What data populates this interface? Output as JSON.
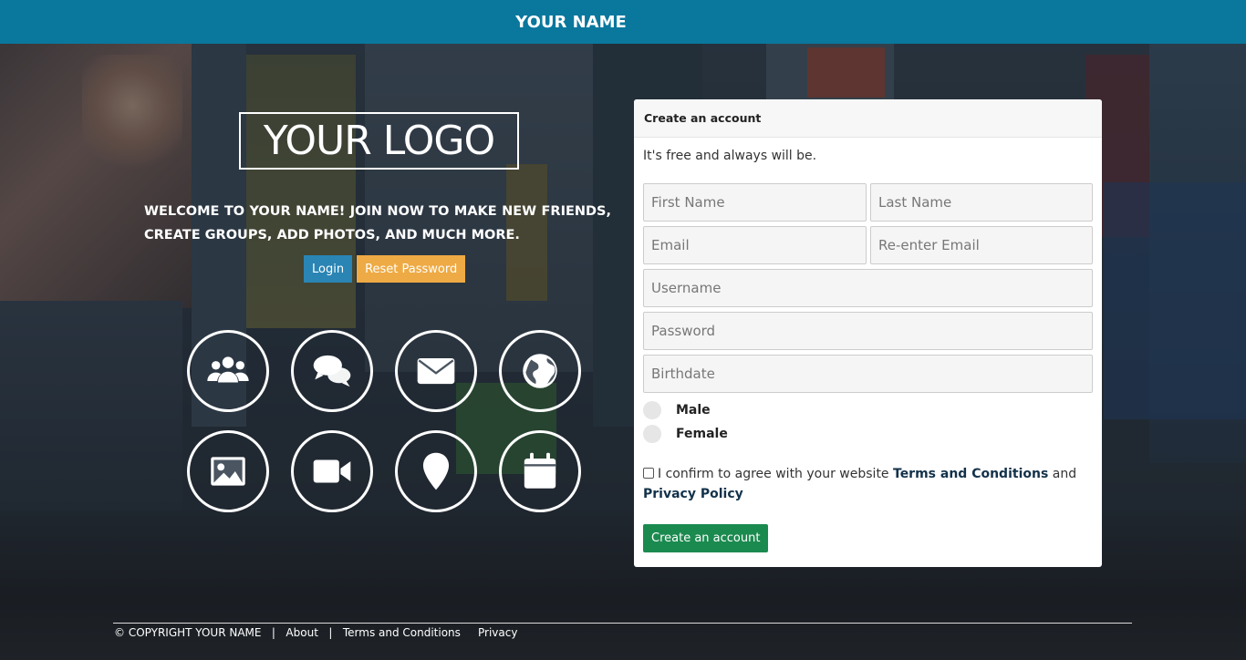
{
  "header": {
    "title": "YOUR NAME"
  },
  "hero": {
    "logo_text": "YOUR LOGO",
    "welcome": "WELCOME TO YOUR NAME! JOIN NOW TO MAKE NEW FRIENDS, CREATE GROUPS, ADD PHOTOS, AND MUCH MORE.",
    "login_label": "Login",
    "reset_label": "Reset Password",
    "features": [
      "users-icon",
      "chat-icon",
      "mail-icon",
      "globe-icon",
      "image-icon",
      "video-icon",
      "location-icon",
      "calendar-icon"
    ]
  },
  "form": {
    "title": "Create an account",
    "subtitle": "It's free and always will be.",
    "first_name_placeholder": "First Name",
    "last_name_placeholder": "Last Name",
    "email_placeholder": "Email",
    "reemail_placeholder": "Re-enter Email",
    "username_placeholder": "Username",
    "password_placeholder": "Password",
    "birthdate_placeholder": "Birthdate",
    "gender_male": "Male",
    "gender_female": "Female",
    "agree_prefix": "I confirm to agree with your website",
    "terms_link": "Terms and Conditions",
    "agree_and": "and",
    "privacy_link": "Privacy Policy",
    "submit_label": "Create an account"
  },
  "footer": {
    "copyright": "© COPYRIGHT YOUR NAME",
    "sep": "|",
    "about": "About",
    "terms": "Terms and Conditions",
    "privacy": "Privacy"
  },
  "colors": {
    "header_bg": "#0a779d",
    "login_btn": "#2a84b4",
    "reset_btn": "#eeaa44",
    "create_btn": "#1b8a4f"
  }
}
